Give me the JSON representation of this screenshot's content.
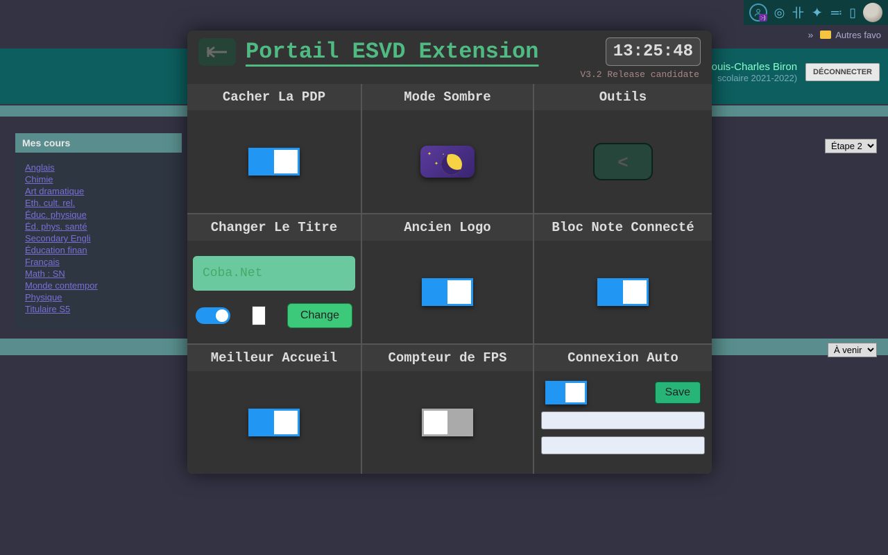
{
  "browser": {
    "face_emoticon": ":-)",
    "more_label": "»",
    "favorites_label": "Autres favo"
  },
  "portal": {
    "user_name": "ouis-Charles Biron",
    "school_year": "scolaire 2021-2022)",
    "logout_label": "DÉCONNECTER",
    "courses_header": "Mes cours",
    "courses": [
      "Anglais",
      "Chimie",
      "Art dramatique",
      "Eth. cult. rel.",
      "Éduc. physique",
      "Éd. phys. santé",
      "Secondary Engli",
      "Éducation finan",
      "Français",
      "Math : SN",
      "Monde contempor",
      "Physique",
      "Titulaire S5"
    ],
    "etape_label": "Étape 2",
    "avenir_label": "À venir"
  },
  "extension": {
    "title": "Portail ESVD Extension",
    "version": "V3.2 Release candidate",
    "clock": "13:25:48",
    "cells": {
      "hide_pdp": {
        "title": "Cacher La PDP"
      },
      "dark_mode": {
        "title": "Mode Sombre"
      },
      "tools": {
        "title": "Outils",
        "button": "<"
      },
      "change_title": {
        "title": "Changer Le Titre",
        "input_value": "Coba.Net",
        "change_btn": "Change"
      },
      "old_logo": {
        "title": "Ancien Logo"
      },
      "bloc_note": {
        "title": "Bloc Note Connecté"
      },
      "better_home": {
        "title": "Meilleur Accueil"
      },
      "fps": {
        "title": "Compteur de FPS"
      },
      "auto_login": {
        "title": "Connexion Auto",
        "save_btn": "Save"
      }
    }
  }
}
